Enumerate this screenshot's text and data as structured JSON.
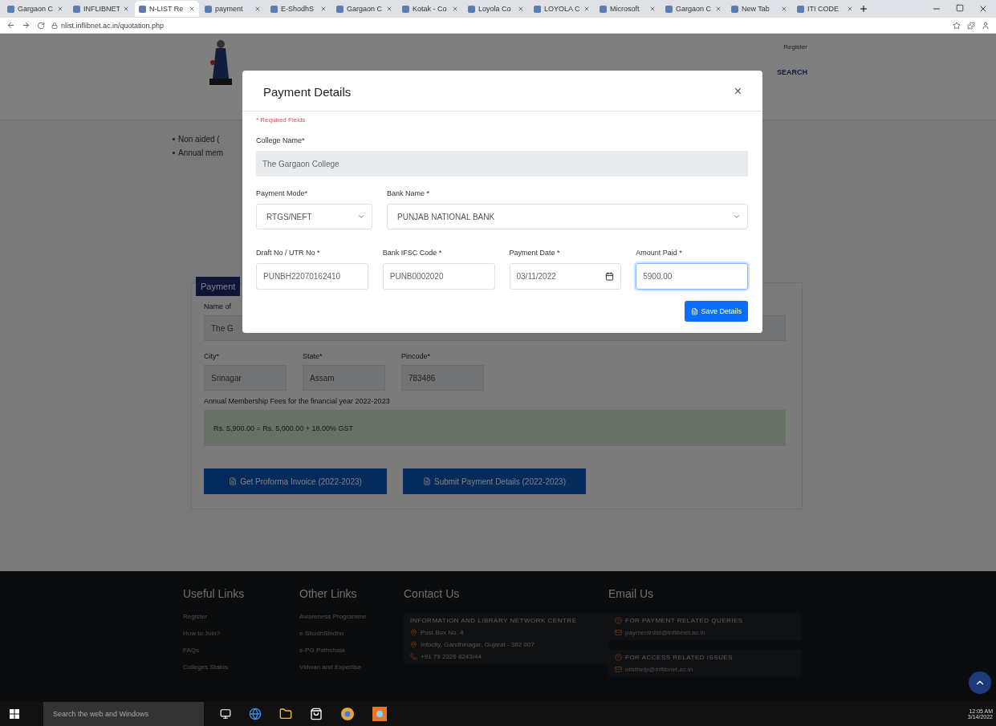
{
  "browser": {
    "tabs": [
      {
        "label": "Gargaon C",
        "selected": false
      },
      {
        "label": "INFLIBNET",
        "selected": false
      },
      {
        "label": "N-LIST Re",
        "selected": true
      },
      {
        "label": "payment",
        "selected": false
      },
      {
        "label": "E-ShodhS",
        "selected": false
      },
      {
        "label": "Gargaon C",
        "selected": false
      },
      {
        "label": "Kotak - Co",
        "selected": false
      },
      {
        "label": "Loyola Co",
        "selected": false
      },
      {
        "label": "LOYOLA C",
        "selected": false
      },
      {
        "label": "Microsoft",
        "selected": false
      },
      {
        "label": "Gargaon C",
        "selected": false
      },
      {
        "label": "New Tab",
        "selected": false
      },
      {
        "label": "ITI CODE",
        "selected": false
      }
    ],
    "address": "nlist.inflibnet.ac.in/quotation.php"
  },
  "header": {
    "top_link": "Register",
    "nav": [
      "SEARCH"
    ]
  },
  "notes": [
    "Non aided (",
    "Annual mem"
  ],
  "panel": {
    "tab": "Payment",
    "name_label": "Name of",
    "name_value": "The G",
    "fields": [
      {
        "label": "City*",
        "value": "Srinagar"
      },
      {
        "label": "State*",
        "value": "Assam"
      },
      {
        "label": "Pincode*",
        "value": "783486"
      }
    ],
    "fee_label": "Annual Membership Fees for the financial year 2022-2023",
    "fee_formula": "Rs. 5,900.00 = Rs. 5,000.00 + 18.00% GST",
    "buttons": [
      "Get Proforma Invoice (2022-2023)",
      "Submit Payment Details (2022-2023)"
    ]
  },
  "footer": {
    "columns": [
      {
        "title": "Useful Links",
        "links": [
          "Register",
          "How to Join?",
          "FAQs",
          "Colleges Status"
        ]
      },
      {
        "title": "Other Links",
        "links": [
          "Awareness Programme",
          "e-ShodhSindhu",
          "e-PG Pathshala",
          "Vidwan and Expertise"
        ]
      }
    ],
    "contact": {
      "title": "Contact Us",
      "org": "INFORMATION AND LIBRARY NETWORK CENTRE",
      "lines": [
        {
          "kind": "pin",
          "text": "Post Box No. 4"
        },
        {
          "kind": "pin",
          "text": "Infocity, Gandhinagar, Gujarat - 382 007"
        },
        {
          "kind": "phone",
          "text": "+91 79 2326 8243/44"
        }
      ]
    },
    "email": {
      "title": "Email Us",
      "groups": [
        {
          "heading": "FOR PAYMENT RELATED QUERIES",
          "address": "paymentnlist@inflibnet.ac.in"
        },
        {
          "heading": "FOR ACCESS RELATED ISSUES",
          "address": "nlisthelp@inflibnet.ac.in"
        }
      ]
    }
  },
  "modal": {
    "title": "Payment Details",
    "close": "×",
    "required_note": "* Required Fields",
    "college": {
      "label": "College Name*",
      "value": "The Gargaon College"
    },
    "payment_mode": {
      "label": "Payment Mode*",
      "value": "RTGS/NEFT"
    },
    "bank": {
      "label": "Bank Name *",
      "value": "PUNJAB NATIONAL BANK"
    },
    "inputs": [
      {
        "kind": "text",
        "label": "Draft No / UTR No *",
        "value": "PUNBH22070162410",
        "focused": false
      },
      {
        "kind": "text",
        "label": "Bank IFSC Code *",
        "value": "PUNB0002020",
        "focused": false
      },
      {
        "kind": "date",
        "label": "Payment Date *",
        "value": "03/11/2022",
        "focused": false
      },
      {
        "kind": "text",
        "label": "Amount Paid *",
        "value": "5900.00",
        "focused": true
      }
    ],
    "save": "Save Details"
  },
  "taskbar": {
    "search": "Search the web and Windows",
    "time": "12:05 AM",
    "date": "3/14/2022"
  }
}
